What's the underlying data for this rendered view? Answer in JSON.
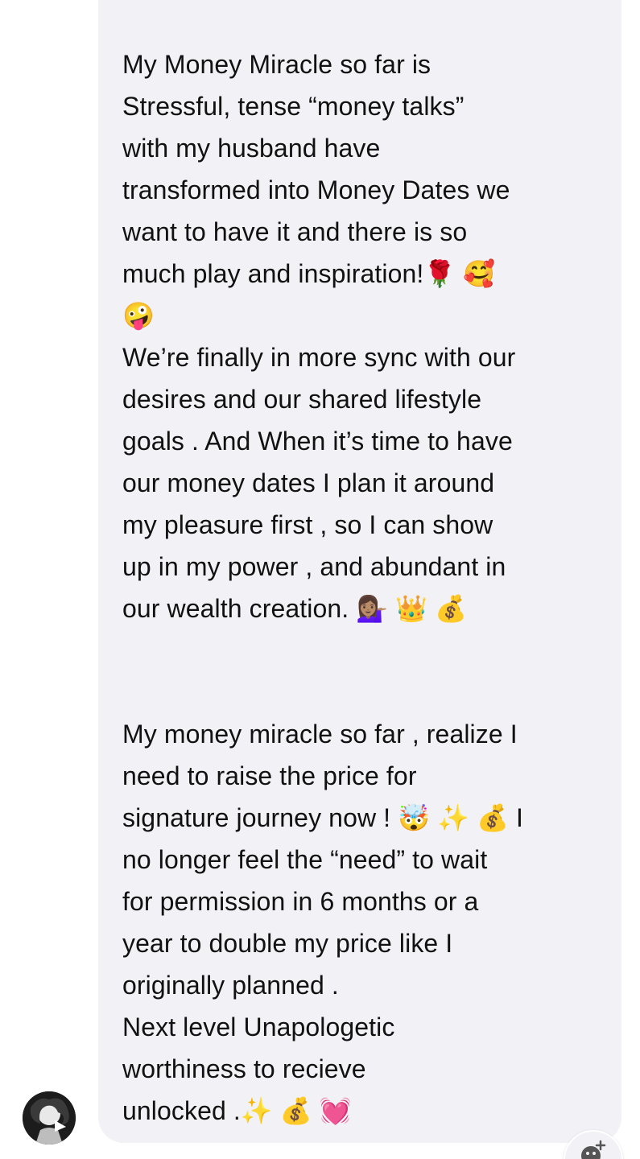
{
  "message": {
    "paragraph_1": "My Money Miracle so far is\nStressful, tense “money talks”\nwith my husband have\ntransformed into Money Dates we\nwant to have it and there is so\nmuch play and inspiration!🌹 🥰\n🤪\nWe’re finally in more sync with our\ndesires and our shared lifestyle\ngoals . And When it’s time to have\nour money dates I plan it  around\nmy pleasure first , so I can show\nup in my power , and abundant in\nour wealth creation. 💁🏽‍♀️ 👑 💰",
    "paragraph_2": "My money miracle so far , realize I\nneed to raise the price for\nsignature journey now ! 🤯  ✨ 💰 I\nno longer feel the “need” to wait\nfor permission in 6 months or a\nyear to double my price like I\noriginally planned .\nNext level Unapologetic\nworthiness to recieve\nunlocked .✨ 💰 💓"
  },
  "icons": {
    "avatar": "user-avatar",
    "reaction": "add-reaction-icon"
  }
}
